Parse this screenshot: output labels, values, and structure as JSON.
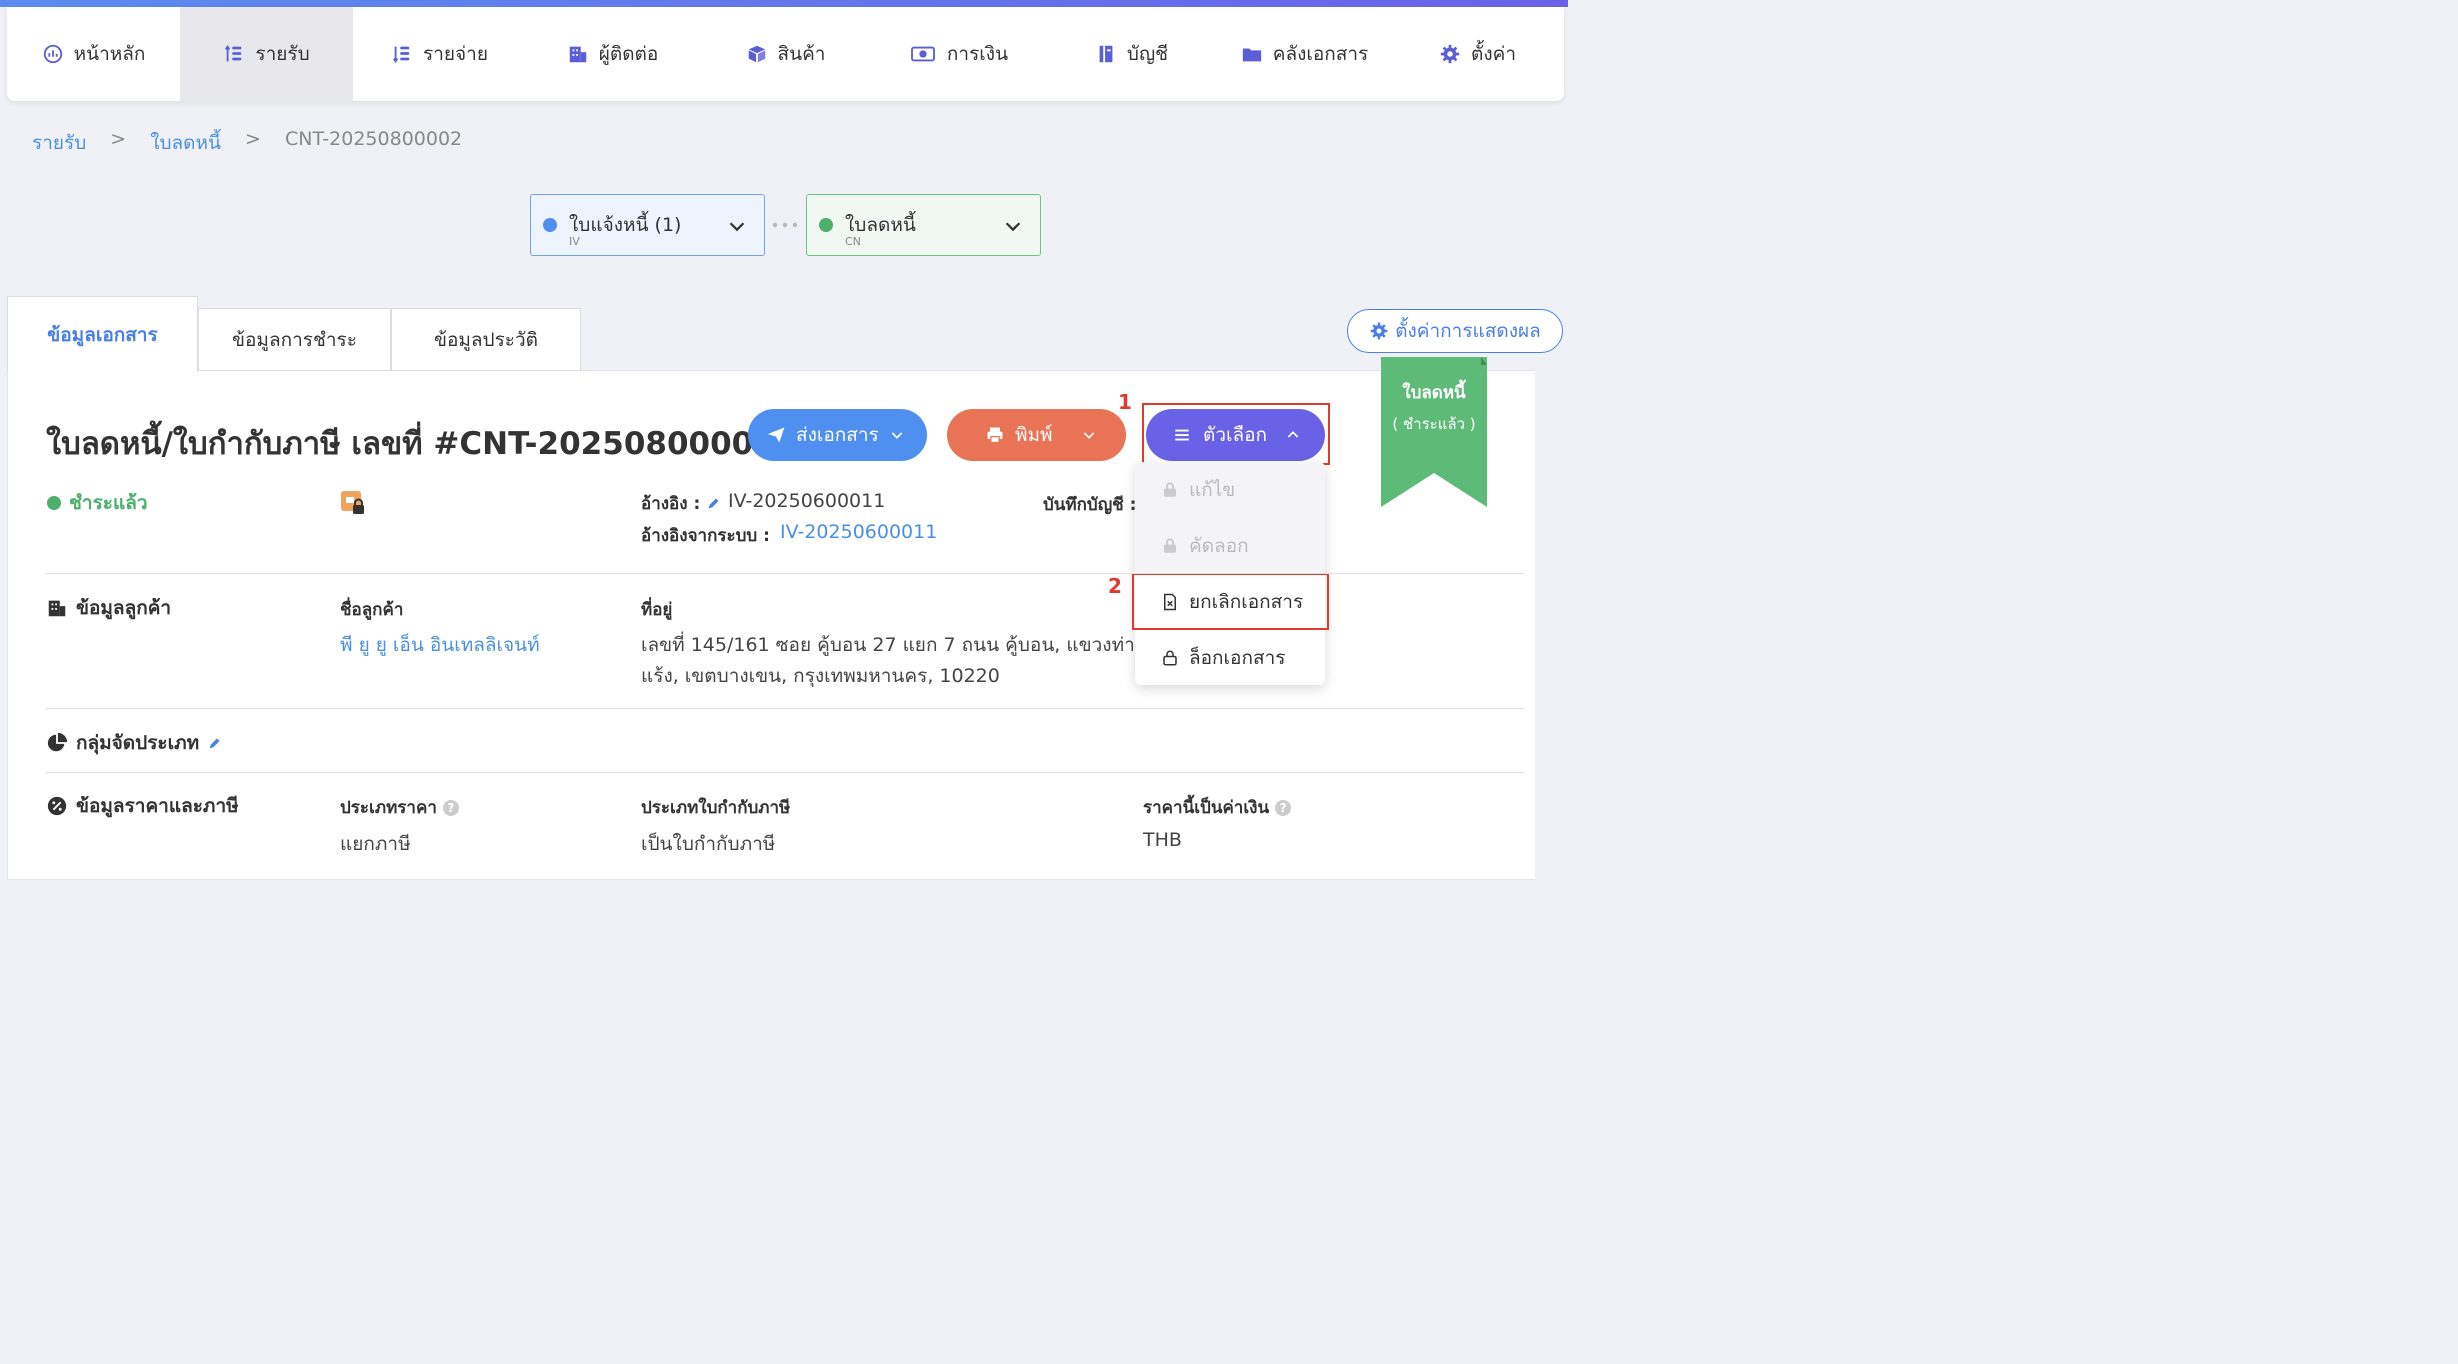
{
  "nav": {
    "items": [
      {
        "label": "หน้าหลัก",
        "icon": "dashboard-icon"
      },
      {
        "label": "รายรับ",
        "icon": "coins-up-icon"
      },
      {
        "label": "รายจ่าย",
        "icon": "coins-down-icon"
      },
      {
        "label": "ผู้ติดต่อ",
        "icon": "building-icon"
      },
      {
        "label": "สินค้า",
        "icon": "box-icon"
      },
      {
        "label": "การเงิน",
        "icon": "money-icon"
      },
      {
        "label": "บัญชี",
        "icon": "ledger-icon"
      },
      {
        "label": "คลังเอกสาร",
        "icon": "folder-icon"
      },
      {
        "label": "ตั้งค่า",
        "icon": "gear-icon"
      }
    ]
  },
  "breadcrumb": {
    "level1": "รายรับ",
    "sep1": ">",
    "level2": "ใบลดหนี้",
    "sep2": ">",
    "current": "CNT-20250800002"
  },
  "flow": {
    "invoice": {
      "label": "ใบแจ้งหนี้ (1)",
      "code": "IV"
    },
    "credit_note": {
      "label": "ใบลดหนี้",
      "code": "CN"
    }
  },
  "tabs": {
    "doc_info": "ข้อมูลเอกสาร",
    "payment_info": "ข้อมูลการชำระ",
    "history_info": "ข้อมูลประวัติ"
  },
  "display_settings": "ตั้งค่าการแสดงผล",
  "ribbon": {
    "line1": "ใบลดหนี้",
    "line2": "( ชำระแล้ว )"
  },
  "doc": {
    "title": "ใบลดหนี้/ใบกำกับภาษี เลขที่ #CNT-20250800002",
    "status": "ชำระแล้ว",
    "reference_label": "อ้างอิง :",
    "reference_value": "IV-20250600011",
    "system_ref_label": "อ้างอิงจากระบบ :",
    "system_ref_value": "IV-20250600011",
    "accounting_label": "บันทึกบัญชี :"
  },
  "buttons": {
    "send": "ส่งเอกสาร",
    "print": "พิมพ์",
    "options": "ตัวเลือก"
  },
  "menu": {
    "edit": "แก้ไข",
    "copy": "คัดลอก",
    "cancel": "ยกเลิกเอกสาร",
    "lock": "ล็อกเอกสาร"
  },
  "annotations": {
    "mark1": "1",
    "mark2": "2"
  },
  "customer": {
    "section": "ข้อมูลลูกค้า",
    "name_label": "ชื่อลูกค้า",
    "name": "พี ยู ยู เอ็น อินเทลลิเจนท์",
    "address_label": "ที่อยู่",
    "address_line1": "เลขที่ 145/161 ซอย คู้บอน 27 แยก 7 ถนน คู้บอน, แขวงท่า",
    "address_line2": "แร้ง, เขตบางเขน, กรุงเทพมหานคร, 10220"
  },
  "category": {
    "section": "กลุ่มจัดประเภท"
  },
  "pricing": {
    "section": "ข้อมูลราคาและภาษี",
    "price_type_label": "ประเภทราคา",
    "price_type": "แยกภาษี",
    "tax_type_label": "ประเภทใบกำกับภาษี",
    "tax_type": "เป็นใบกำกับภาษี",
    "currency_label": "ราคานี้เป็นค่าเงิน",
    "currency": "THB"
  },
  "colors": {
    "accent": "#4a7fe8",
    "send": "#4e8ff0",
    "print": "#e97355",
    "options": "#6a62e6",
    "paid": "#4caf6a",
    "annotation": "#e03a2c"
  }
}
